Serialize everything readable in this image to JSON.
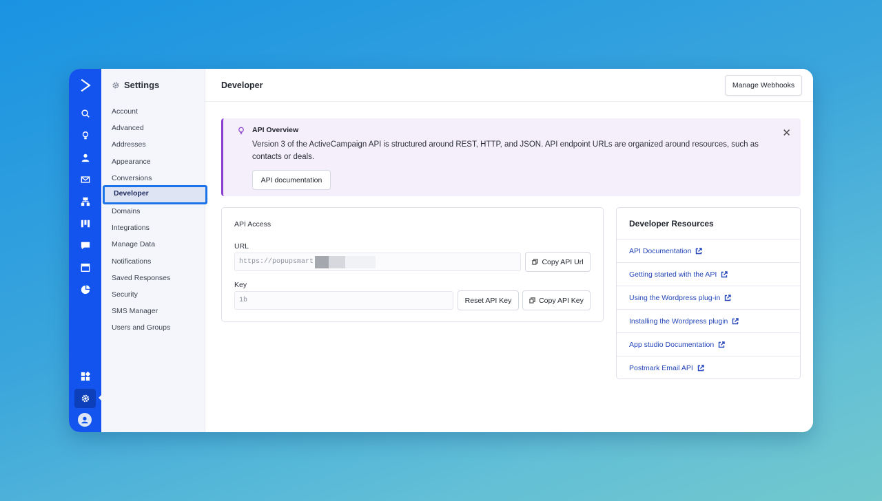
{
  "sidebar": {
    "title": "Settings",
    "items": [
      {
        "label": "Account"
      },
      {
        "label": "Advanced"
      },
      {
        "label": "Addresses"
      },
      {
        "label": "Appearance"
      },
      {
        "label": "Conversions"
      },
      {
        "label": "Developer",
        "active": true
      },
      {
        "label": "Domains"
      },
      {
        "label": "Integrations"
      },
      {
        "label": "Manage Data"
      },
      {
        "label": "Notifications"
      },
      {
        "label": "Saved Responses"
      },
      {
        "label": "Security"
      },
      {
        "label": "SMS Manager"
      },
      {
        "label": "Users and Groups"
      }
    ]
  },
  "header": {
    "title": "Developer",
    "webhooks_button": "Manage Webhooks"
  },
  "alert": {
    "title": "API Overview",
    "body": "Version 3 of the ActiveCampaign API is structured around REST, HTTP, and JSON. API endpoint URLs are organized around resources, such as contacts or deals.",
    "button": "API documentation"
  },
  "api_access": {
    "title": "API Access",
    "url_label": "URL",
    "url_value": "https://popupsmart",
    "copy_url_button": "Copy API Url",
    "key_label": "Key",
    "key_value": "1b",
    "reset_button": "Reset API Key",
    "copy_key_button": "Copy API Key"
  },
  "resources": {
    "title": "Developer Resources",
    "links": [
      {
        "label": "API Documentation"
      },
      {
        "label": "Getting started with the API"
      },
      {
        "label": "Using the Wordpress plug-in"
      },
      {
        "label": "Installing the Wordpress plugin"
      },
      {
        "label": "App studio Documentation"
      },
      {
        "label": "Postmark Email API"
      }
    ]
  },
  "colors": {
    "rail": "#1354ee",
    "alert_bg": "#f5eefb",
    "alert_accent": "#8a3fd1",
    "link": "#2446b8",
    "highlight_border": "#1a73e8"
  }
}
